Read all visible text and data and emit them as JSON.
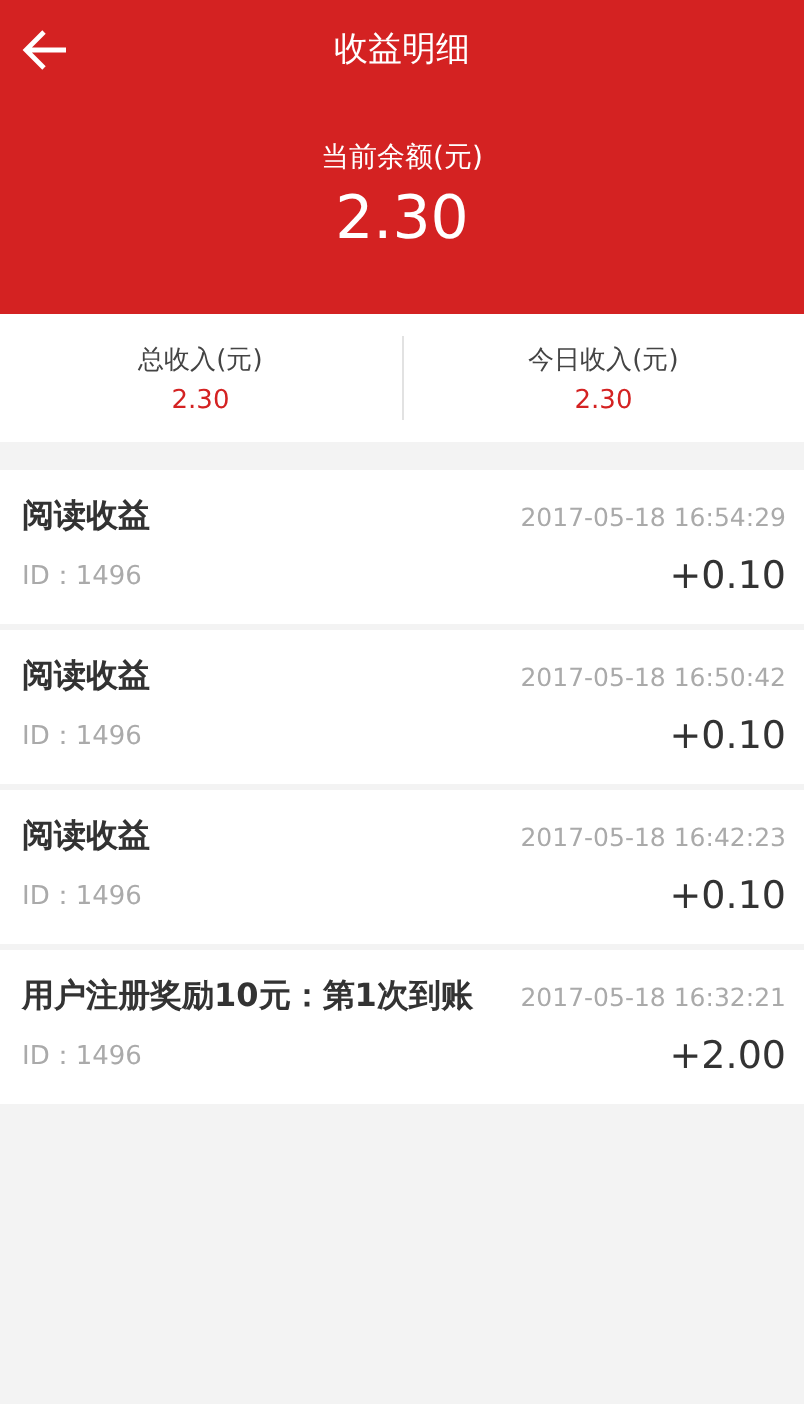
{
  "header": {
    "title": "收益明细",
    "balance_label": "当前余额(元)",
    "balance": "2.30"
  },
  "summary": [
    {
      "label": "总收入(元)",
      "value": "2.30"
    },
    {
      "label": "今日收入(元)",
      "value": "2.30"
    }
  ],
  "records": [
    {
      "title": "阅读收益",
      "time": "2017-05-18 16:54:29",
      "id": "ID：1496",
      "amount": "+0.10"
    },
    {
      "title": "阅读收益",
      "time": "2017-05-18 16:50:42",
      "id": "ID：1496",
      "amount": "+0.10"
    },
    {
      "title": "阅读收益",
      "time": "2017-05-18 16:42:23",
      "id": "ID：1496",
      "amount": "+0.10"
    },
    {
      "title": "用户注册奖励10元：第1次到账",
      "time": "2017-05-18 16:32:21",
      "id": "ID：1496",
      "amount": "+2.00"
    }
  ]
}
